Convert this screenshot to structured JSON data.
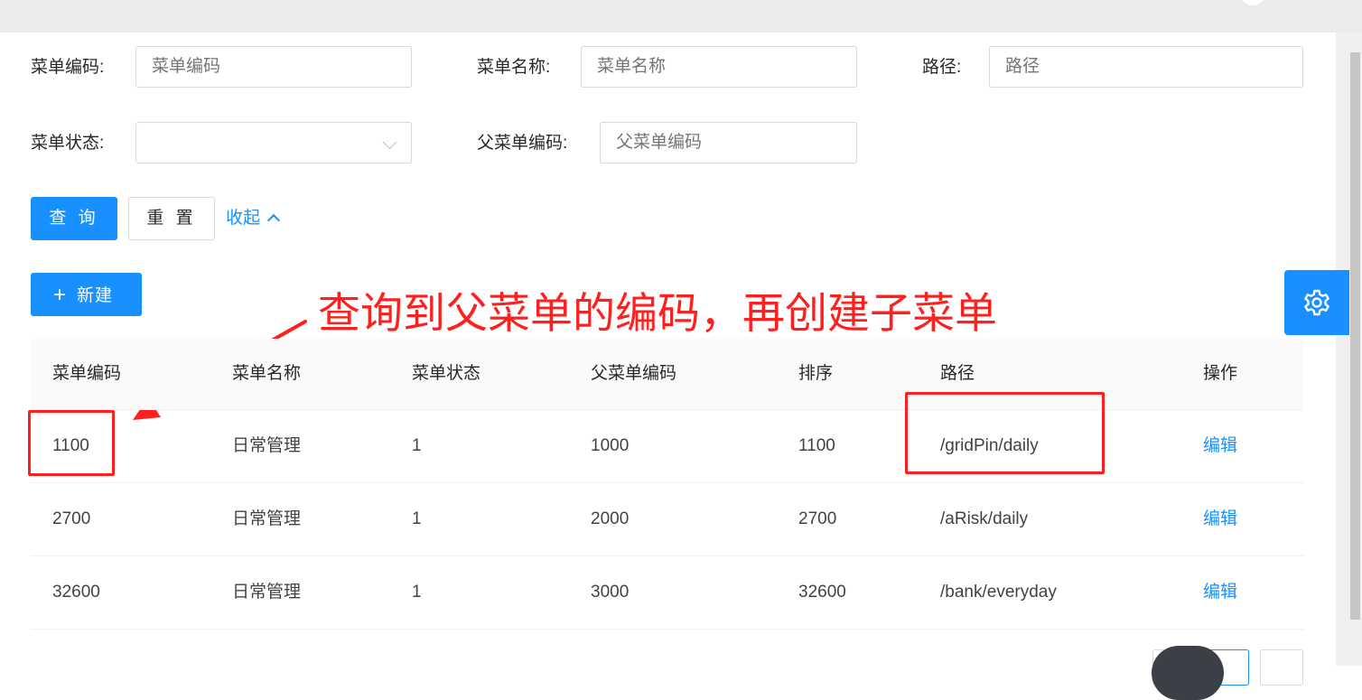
{
  "search_form": {
    "menu_code": {
      "label": "菜单编码:",
      "placeholder": "菜单编码"
    },
    "menu_name": {
      "label": "菜单名称:",
      "placeholder": "菜单名称"
    },
    "path": {
      "label": "路径:",
      "placeholder": "路径"
    },
    "menu_status": {
      "label": "菜单状态:",
      "value": ""
    },
    "parent_code": {
      "label": "父菜单编码:",
      "placeholder": "父菜单编码"
    },
    "query_button": "查 询",
    "reset_button": "重 置",
    "collapse_link": "收起"
  },
  "toolbar": {
    "new_button": "新建"
  },
  "annotation": {
    "text": "查询到父菜单的编码，再创建子菜单",
    "color": "#ff1f1f"
  },
  "table": {
    "columns": [
      "菜单编码",
      "菜单名称",
      "菜单状态",
      "父菜单编码",
      "排序",
      "路径",
      "操作"
    ],
    "rows": [
      {
        "code": "1100",
        "name": "日常管理",
        "status": "1",
        "parent": "1000",
        "order": "1100",
        "path": "/gridPin/daily",
        "action": "编辑"
      },
      {
        "code": "2700",
        "name": "日常管理",
        "status": "1",
        "parent": "2000",
        "order": "2700",
        "path": "/aRisk/daily",
        "action": "编辑"
      },
      {
        "code": "32600",
        "name": "日常管理",
        "status": "1",
        "parent": "3000",
        "order": "32600",
        "path": "/bank/everyday",
        "action": "编辑"
      }
    ]
  },
  "colors": {
    "primary": "#1890ff",
    "annotation": "#ff1f1f",
    "border": "#d9d9d9"
  },
  "icons": [
    "plus-icon",
    "chevron-up-icon",
    "chevron-down-icon",
    "gear-icon"
  ]
}
